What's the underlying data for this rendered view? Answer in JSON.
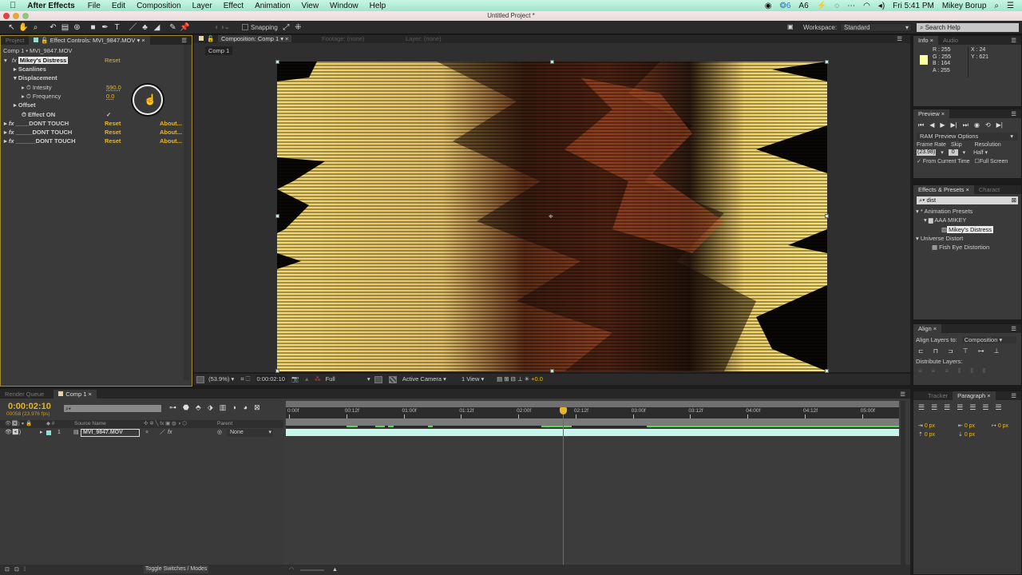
{
  "menubar": {
    "app": "After Effects",
    "items": [
      "File",
      "Edit",
      "Composition",
      "Layer",
      "Effect",
      "Animation",
      "View",
      "Window",
      "Help"
    ],
    "status": {
      "cc_badge": "6",
      "ai_badge": "6",
      "clock": "Fri 5:41 PM",
      "user": "Mikey Borup"
    }
  },
  "window": {
    "title": "Untitled Project *"
  },
  "toolbar": {
    "snapping_label": "Snapping",
    "workspace_label": "Workspace:",
    "workspace_value": "Standard",
    "search_placeholder": "Search Help"
  },
  "left_panel": {
    "tabs": [
      {
        "label": "Project"
      },
      {
        "label": "Effect Controls: MVI_9847.MOV"
      }
    ],
    "breadcrumb": "Comp 1 • MVI_9847.MOV",
    "effects": [
      {
        "name": "Mikey's Distress",
        "reset": "Reset"
      },
      {
        "name": "____DONT TOUCH",
        "reset": "Reset",
        "about": "About..."
      },
      {
        "name": "_____DONT TOUCH",
        "reset": "Reset",
        "about": "About..."
      },
      {
        "name": "______DONT TOUCH",
        "reset": "Reset",
        "about": "About..."
      }
    ],
    "groups": {
      "scanlines": "Scanlines",
      "displacement": "Displacement",
      "offset": "Offset"
    },
    "props": {
      "intensity_label": "Intesity",
      "intensity_value": "590.0",
      "frequency_label": "Frequency",
      "frequency_value": "0.0",
      "effect_on_label": "Effect ON",
      "effect_on_value": "✓"
    }
  },
  "viewer": {
    "tabs": [
      {
        "label": "Composition: Comp 1"
      },
      {
        "label": "Footage: (none)"
      },
      {
        "label": "Layer: (none)"
      }
    ],
    "comp_button": "Comp 1",
    "footer": {
      "zoom": "(53.9%)",
      "timecode": "0:00:02:10",
      "resolution": "Full",
      "camera": "Active Camera",
      "views": "1 View",
      "exposure": "+0.0"
    }
  },
  "info_panel": {
    "tabs": [
      {
        "label": "Info"
      },
      {
        "label": "Audio"
      }
    ],
    "swatch_color": "#ffffa4",
    "r": "R : 255",
    "g": "G : 255",
    "b": "B : 164",
    "a": "A : 255",
    "x": "X : 24",
    "y": "Y : 621"
  },
  "preview_panel": {
    "tab": "Preview",
    "ram_options": "RAM Preview Options",
    "frame_rate_label": "Frame Rate",
    "skip_label": "Skip",
    "resolution_label": "Resolution",
    "frame_rate_value": "(23.98)",
    "skip_value": "0",
    "resolution_value": "Half",
    "from_current": "From Current Time",
    "full_screen": "Full Screen"
  },
  "effects_presets": {
    "tabs": [
      {
        "label": "Effects & Presets"
      },
      {
        "label": "Charact"
      }
    ],
    "search_value": "dist",
    "tree": [
      {
        "label": "* Animation Presets"
      },
      {
        "label": "AAA MIKEY"
      },
      {
        "label": "Mikey's Distress"
      },
      {
        "label": "Universe Distort"
      },
      {
        "label": "Fish Eye Distortion"
      }
    ]
  },
  "align_panel": {
    "tab": "Align",
    "align_to_label": "Align Layers to:",
    "align_to_value": "Composition",
    "distribute_label": "Distribute Layers:"
  },
  "paragraph_panel": {
    "tabs": [
      {
        "label": "Tracker"
      },
      {
        "label": "Paragraph"
      }
    ],
    "values": [
      "0 px",
      "0 px",
      "0 px",
      "0 px",
      "0 px"
    ]
  },
  "timeline": {
    "tabs": [
      {
        "label": "Render Queue"
      },
      {
        "label": "Comp 1"
      }
    ],
    "timecode": "0:00:02:10",
    "frame_info": "00058 (23.976 fps)",
    "columns": {
      "source": "Source Name",
      "parent": "Parent"
    },
    "layer": {
      "index": "1",
      "name": "MVI_9847.MOV",
      "parent": "None"
    },
    "ruler": [
      "0:00f",
      "00:12f",
      "01:00f",
      "01:12f",
      "02:00f",
      "02:12f",
      "03:00f",
      "03:12f",
      "04:00f",
      "04:12f",
      "05:00f"
    ],
    "playhead_position_seconds": 2.42,
    "toggle_label": "Toggle Switches / Modes"
  }
}
